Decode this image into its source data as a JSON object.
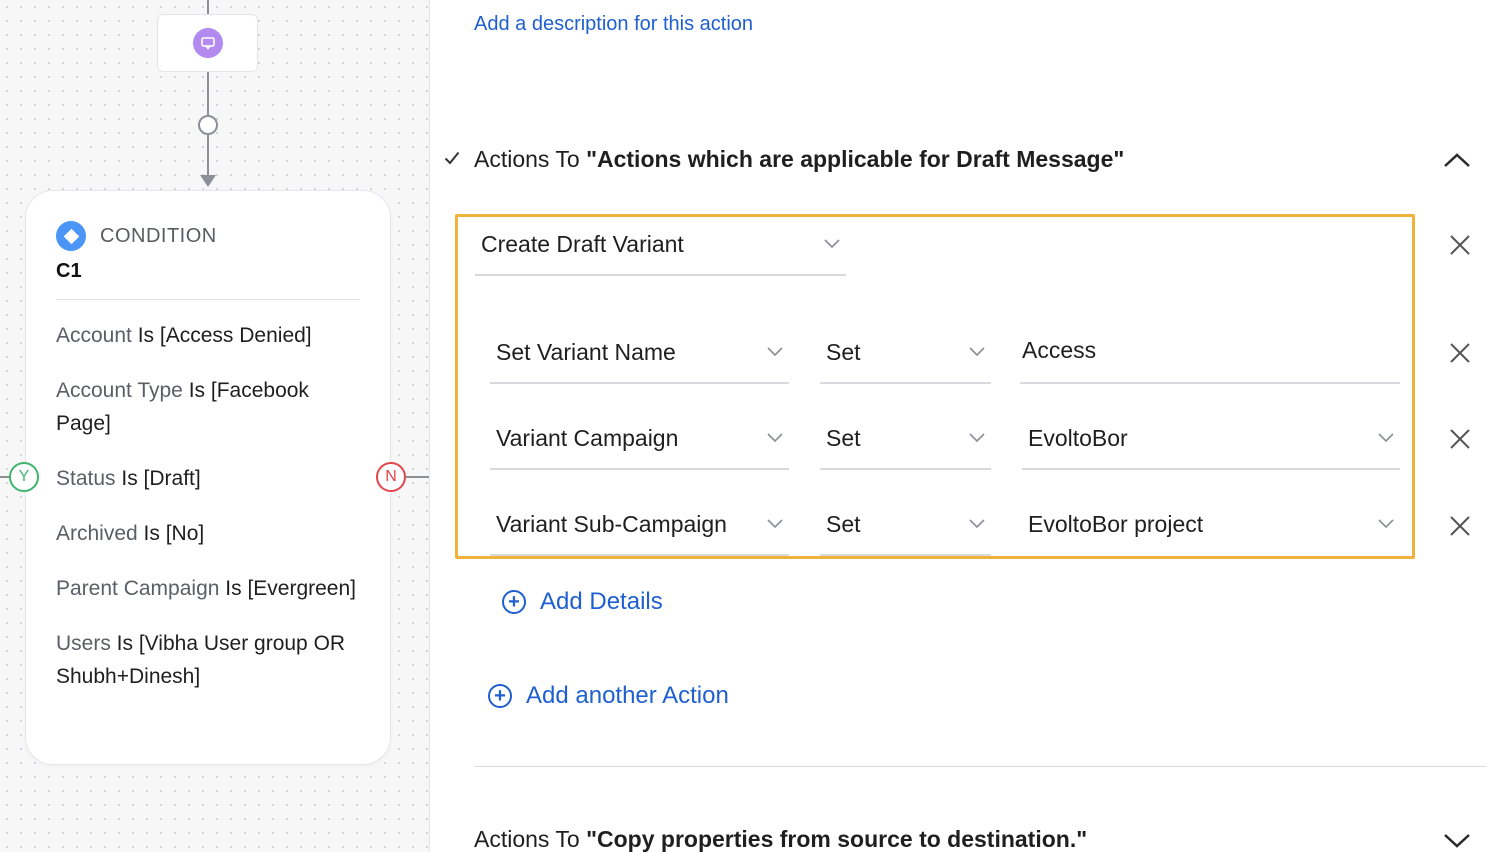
{
  "canvas": {
    "condition": {
      "type_label": "CONDITION",
      "name": "C1",
      "rules": [
        {
          "field": "Account",
          "expr": " Is [Access Denied]"
        },
        {
          "field": "Account Type",
          "expr": " Is [Facebook Page]"
        },
        {
          "field": "Status",
          "expr": " Is [Draft]"
        },
        {
          "field": "Archived",
          "expr": " Is [No]"
        },
        {
          "field": "Parent Campaign",
          "expr": " Is [Evergreen]"
        },
        {
          "field": "Users",
          "expr": " Is [Vibha User group OR Shubh+Dinesh]"
        }
      ]
    },
    "branch_yes": "Y",
    "branch_no": "N"
  },
  "panel": {
    "description_link": "Add a description for this action",
    "section1": {
      "prefix": "Actions To ",
      "title": "\"Actions which are applicable for Draft Message\""
    },
    "action": {
      "type": "Create Draft Variant",
      "details": [
        {
          "field": "Set Variant Name",
          "operator": "Set",
          "value": "Access",
          "value_kind": "text"
        },
        {
          "field": "Variant Campaign",
          "operator": "Set",
          "value": "EvoltoBor",
          "value_kind": "select"
        },
        {
          "field": "Variant Sub-Campaign",
          "operator": "Set",
          "value": "EvoltoBor project",
          "value_kind": "select"
        }
      ]
    },
    "add_details": "Add Details",
    "add_action": "Add another Action",
    "section2": {
      "prefix": "Actions To ",
      "title": "\"Copy properties from source to destination.\""
    }
  },
  "colors": {
    "highlight": "#f0b23c",
    "link": "#1f5fd1",
    "condition_icon": "#4a95f5",
    "message_icon": "#b28af0",
    "branch_yes": "#3fb56e",
    "branch_no": "#e0464c"
  },
  "icons": {
    "message": "chat-bubble-icon",
    "condition": "diamond-icon",
    "check": "check-icon",
    "collapse": "chevron-up-icon",
    "expand": "chevron-down-icon",
    "remove": "close-icon",
    "add": "plus-circle-icon"
  }
}
